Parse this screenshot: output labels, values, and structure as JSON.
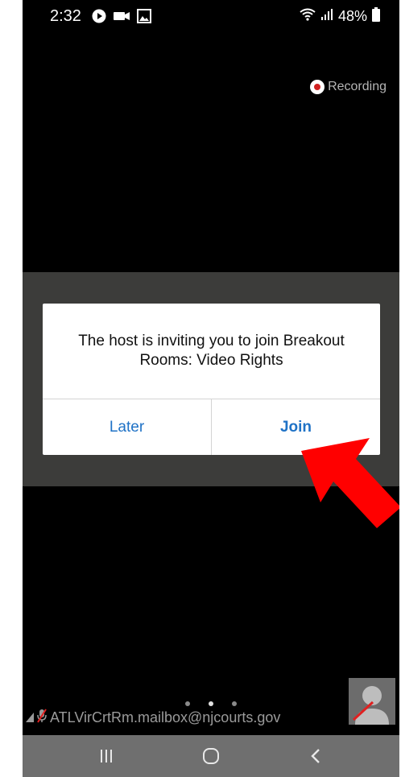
{
  "status_bar": {
    "time": "2:32",
    "icons": [
      "media-play-icon",
      "video-camera-icon",
      "gallery-icon"
    ],
    "right_icons": [
      "wifi-icon",
      "signal-icon"
    ],
    "battery": "48%"
  },
  "recording": {
    "label": "Recording"
  },
  "dialog": {
    "message": "The host is inviting you to join Breakout Rooms: Video Rights",
    "later_label": "Later",
    "join_label": "Join"
  },
  "participant": {
    "name": "ATLVirCrtRm.mailbox@njcourts.gov"
  },
  "pager": {
    "count": 3,
    "active": 1
  },
  "navigation": {
    "buttons": [
      "recent-apps-icon",
      "home-icon",
      "back-icon"
    ]
  },
  "colors": {
    "accent": "#1f72c6",
    "arrow": "#ff0000",
    "recording_dot": "#d02020",
    "background": "#000000"
  }
}
